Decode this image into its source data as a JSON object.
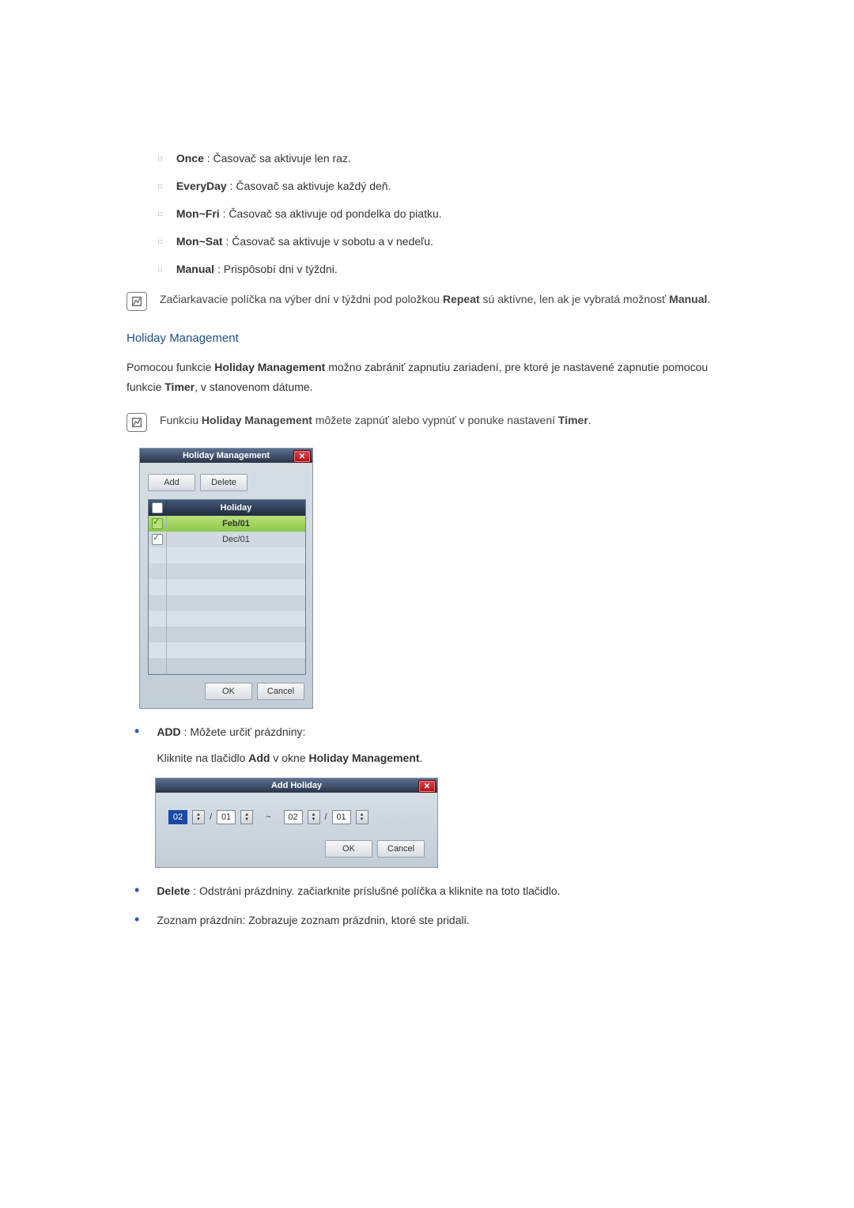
{
  "repeat_options": [
    {
      "label": "Once",
      "desc": " : Časovač sa aktivuje len raz."
    },
    {
      "label": "EveryDay",
      "desc": " : Časovač sa aktivuje každý deň."
    },
    {
      "label": "Mon~Fri",
      "desc": " : Časovač sa aktivuje od pondelka do piatku."
    },
    {
      "label": "Mon~Sat",
      "desc": " : Časovač sa aktivuje v sobotu a v nedeľu."
    },
    {
      "label": "Manual",
      "desc": " : Prispôsobí dni v týždni."
    }
  ],
  "note1_pre": "Začiarkavacie políčka na výber dní v týždni pod položkou ",
  "note1_b1": "Repeat",
  "note1_mid": " sú aktívne, len ak je vybratá možnosť ",
  "note1_b2": "Manual",
  "note1_post": ".",
  "section_heading": "Holiday Management",
  "para1_pre": "Pomocou funkcie ",
  "para1_b1": "Holiday Management",
  "para1_mid": " možno zabrániť zapnutiu zariadení, pre ktoré je nastavené zapnutie pomocou funkcie ",
  "para1_b2": "Timer",
  "para1_post": ", v stanovenom dátume.",
  "note2_pre": "Funkciu ",
  "note2_b1": "Holiday Management",
  "note2_mid": " môžete zapnúť alebo vypnúť v ponuke nastavení ",
  "note2_b2": "Timer",
  "note2_post": ".",
  "holiday_dlg": {
    "title": "Holiday Management",
    "add": "Add",
    "delete": "Delete",
    "header": "Holiday",
    "rows": [
      "Feb/01",
      "Dec/01"
    ],
    "ok": "OK",
    "cancel": "Cancel"
  },
  "add_b": "ADD",
  "add_desc": " : Môžete určiť prázdniny:",
  "add_line2_pre": "Kliknite na tlačidlo ",
  "add_line2_b1": "Add",
  "add_line2_mid": " v okne ",
  "add_line2_b2": "Holiday Management",
  "add_line2_post": ".",
  "add_dlg": {
    "title": "Add Holiday",
    "m1": "02",
    "d1": "01",
    "m2": "02",
    "d2": "01",
    "slash": "/",
    "tilde": "~",
    "ok": "OK",
    "cancel": "Cancel"
  },
  "delete_b": "Delete",
  "delete_desc": " : Odstráni prázdniny. začiarknite príslušné políčka a kliknite na toto tlačidlo.",
  "list_desc": "Zoznam prázdnin: Zobrazuje zoznam prázdnin, ktoré ste pridali.",
  "chart_data": null
}
